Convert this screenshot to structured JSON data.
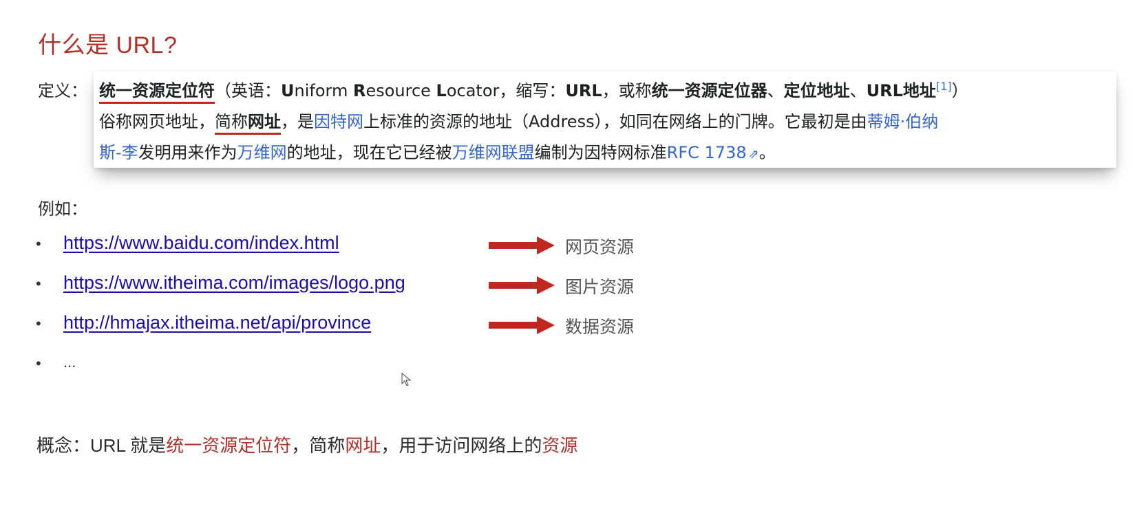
{
  "title": "什么是 URL?",
  "definition": {
    "label": "定义：",
    "term": "统一资源定位符",
    "l1_a": "（英语：",
    "l1_u": "U",
    "l1_b": "niform ",
    "l1_r": "R",
    "l1_c": "esource ",
    "l1_l": "L",
    "l1_d": "ocator，缩写：",
    "abbr": "URL",
    "l1_e": "，或称",
    "alt1": "统一资源定位器",
    "sep1": "、",
    "alt2": "定位地址",
    "sep2": "、",
    "alt3": "URL地址",
    "ref": "[1]",
    "l1_end": "）",
    "l2_a": "俗称网页地址，",
    "l2_short_a": "简称",
    "l2_short_b": "网址",
    "l2_b": "，是",
    "link_internet": "因特网",
    "l2_c": "上标准的资源的地址（Address），如同在网络上的门牌。它最初是由",
    "link_tbl_a": "蒂姆·伯纳",
    "link_tbl_b": "斯-李",
    "l3_a": "发明用来作为",
    "link_www": "万维网",
    "l3_b": "的地址，现在它已经被",
    "link_w3c": "万维网联盟",
    "l3_c": "编制为因特网标准",
    "link_rfc": "RFC 1738",
    "l3_end": "。"
  },
  "examples": {
    "label": "例如：",
    "items": [
      {
        "url": "https://www.baidu.com/index.html",
        "desc": "网页资源"
      },
      {
        "url": "https://www.itheima.com/images/logo.png",
        "desc": "图片资源"
      },
      {
        "url": "http://hmajax.itheima.net/api/province",
        "desc": "数据资源"
      }
    ],
    "more": "..."
  },
  "concept": {
    "prefix": "概念：URL 就是",
    "hl1": "统一资源定位符",
    "mid1": "，简称",
    "hl2": "网址",
    "mid2": "，用于访问网络上的",
    "hl3": "资源"
  },
  "colors": {
    "title": "#b2302a",
    "arrow": "#c0281f",
    "link": "#1a0dab",
    "wiki_link": "#3366cc"
  }
}
